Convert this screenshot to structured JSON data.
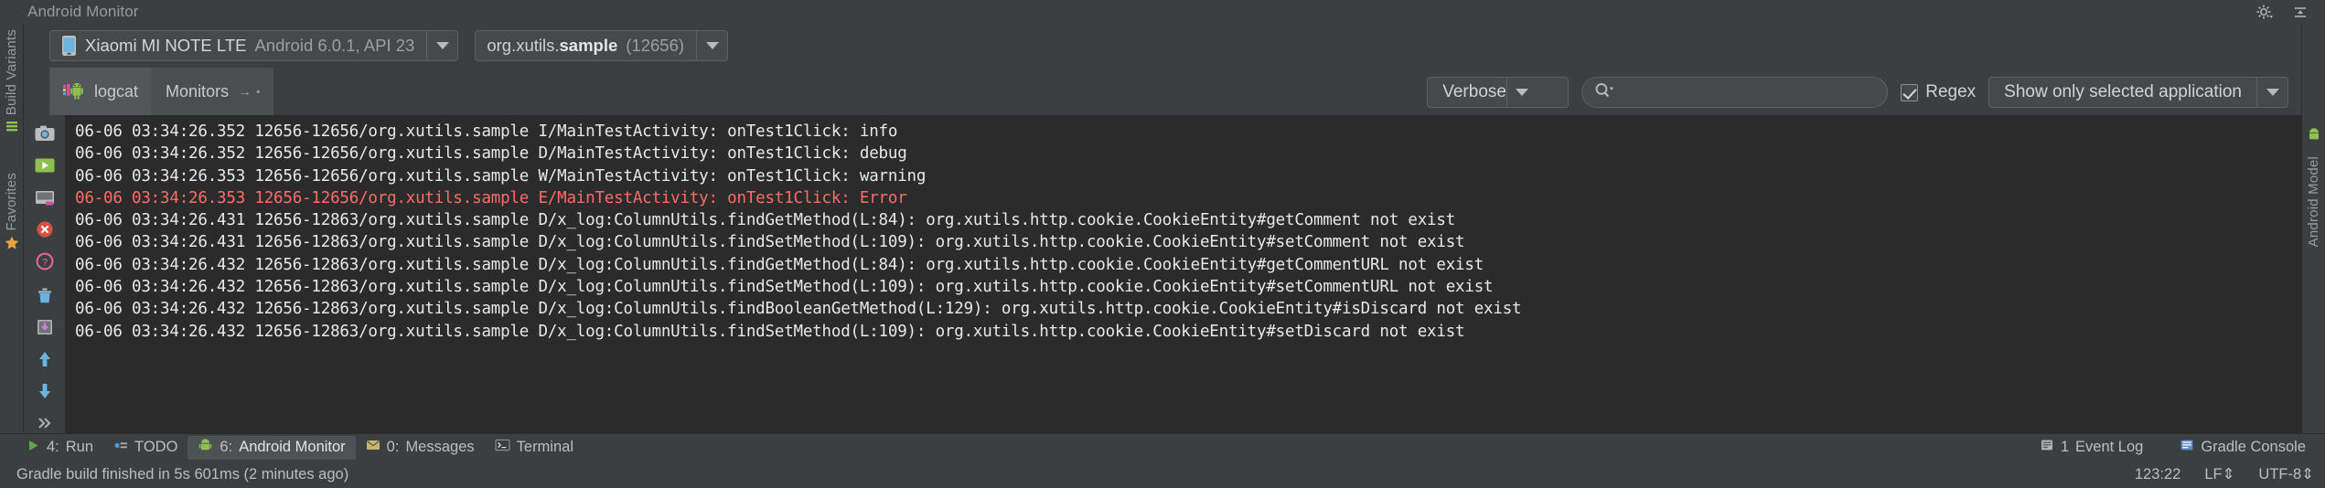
{
  "window": {
    "title": "Android Monitor",
    "settings_icon": "gear-icon",
    "hide_icon": "hide-window-icon"
  },
  "left_rail": {
    "items": [
      {
        "label": "Build Variants",
        "icon": "build-variants-icon"
      },
      {
        "label": "Favorites",
        "icon": "star-icon"
      }
    ]
  },
  "right_rail": {
    "items": [
      {
        "label": "Android Model",
        "icon": "android-model-icon"
      }
    ]
  },
  "device_selector": {
    "icon": "phone-icon",
    "name": "Xiaomi MI NOTE LTE",
    "meta": "Android 6.0.1, API 23",
    "caret": "chevron-down-icon"
  },
  "process_selector": {
    "package_prefix": "org.xutils.",
    "package_bold": "sample",
    "pid": "(12656)",
    "caret": "chevron-down-icon"
  },
  "tabs": [
    {
      "label": "logcat",
      "icon": "android-robot-icon",
      "active": true
    },
    {
      "label": "Monitors",
      "icon": "",
      "active": false,
      "suffix": "→"
    }
  ],
  "filters": {
    "log_level": "Verbose",
    "log_level_caret": "chevron-down-icon",
    "search_value": "",
    "search_placeholder": "",
    "search_icon": "search-icon",
    "regex_label": "Regex",
    "regex_checked": true,
    "app_filter": "Show only selected application",
    "app_filter_caret": "chevron-down-icon"
  },
  "log_tools": [
    {
      "icon": "camera-icon"
    },
    {
      "icon": "play-icon"
    },
    {
      "icon": "screen-record-icon"
    },
    {
      "icon": "stop-icon"
    },
    {
      "icon": "help-icon"
    },
    {
      "icon": "trash-icon"
    },
    {
      "icon": "export-icon"
    },
    {
      "icon": "scroll-up-icon"
    },
    {
      "icon": "scroll-down-icon"
    },
    {
      "icon": "more-icon"
    }
  ],
  "log_lines": [
    {
      "text": "06-06 03:34:26.352 12656-12656/org.xutils.sample I/MainTestActivity: onTest1Click: info",
      "level": "I"
    },
    {
      "text": "06-06 03:34:26.352 12656-12656/org.xutils.sample D/MainTestActivity: onTest1Click: debug",
      "level": "D"
    },
    {
      "text": "06-06 03:34:26.353 12656-12656/org.xutils.sample W/MainTestActivity: onTest1Click: warning",
      "level": "W"
    },
    {
      "text": "06-06 03:34:26.353 12656-12656/org.xutils.sample E/MainTestActivity: onTest1Click: Error",
      "level": "E"
    },
    {
      "text": "06-06 03:34:26.431 12656-12863/org.xutils.sample D/x_log:ColumnUtils.findGetMethod(L:84): org.xutils.http.cookie.CookieEntity#getComment not exist",
      "level": "D"
    },
    {
      "text": "06-06 03:34:26.431 12656-12863/org.xutils.sample D/x_log:ColumnUtils.findSetMethod(L:109): org.xutils.http.cookie.CookieEntity#setComment not exist",
      "level": "D"
    },
    {
      "text": "06-06 03:34:26.432 12656-12863/org.xutils.sample D/x_log:ColumnUtils.findGetMethod(L:84): org.xutils.http.cookie.CookieEntity#getCommentURL not exist",
      "level": "D"
    },
    {
      "text": "06-06 03:34:26.432 12656-12863/org.xutils.sample D/x_log:ColumnUtils.findSetMethod(L:109): org.xutils.http.cookie.CookieEntity#setCommentURL not exist",
      "level": "D"
    },
    {
      "text": "06-06 03:34:26.432 12656-12863/org.xutils.sample D/x_log:ColumnUtils.findBooleanGetMethod(L:129): org.xutils.http.cookie.CookieEntity#isDiscard not exist",
      "level": "D"
    },
    {
      "text": "06-06 03:34:26.432 12656-12863/org.xutils.sample D/x_log:ColumnUtils.findSetMethod(L:109): org.xutils.http.cookie.CookieEntity#setDiscard not exist",
      "level": "D"
    }
  ],
  "bottom_tabs": [
    {
      "num": "4:",
      "label": "Run",
      "icon": "play-green-icon",
      "active": false
    },
    {
      "num": "",
      "label": "TODO",
      "icon": "todo-icon",
      "active": false
    },
    {
      "num": "6:",
      "label": "Android Monitor",
      "icon": "android-robot-icon",
      "active": true
    },
    {
      "num": "0:",
      "label": "Messages",
      "icon": "messages-icon",
      "active": false
    },
    {
      "num": "",
      "label": "Terminal",
      "icon": "terminal-icon",
      "active": false
    }
  ],
  "bottom_tabs_right": [
    {
      "num": "1",
      "label": "Event Log",
      "icon": "event-log-icon"
    },
    {
      "num": "",
      "label": "Gradle Console",
      "icon": "gradle-console-icon"
    }
  ],
  "status_bar": {
    "message": "Gradle build finished in 5s 601ms (2 minutes ago)",
    "caret_position": "123:22",
    "line_separator": "LF",
    "line_separator_caret": "⇕",
    "encoding": "UTF-8",
    "encoding_caret": "⇕"
  },
  "colors": {
    "panel_bg": "#3c3f41",
    "log_bg": "#2b2b2b",
    "error_text": "#ff6b68",
    "text": "#d6d6d6",
    "muted": "#9a9a9a",
    "accent_blue": "#6bb3e0"
  }
}
